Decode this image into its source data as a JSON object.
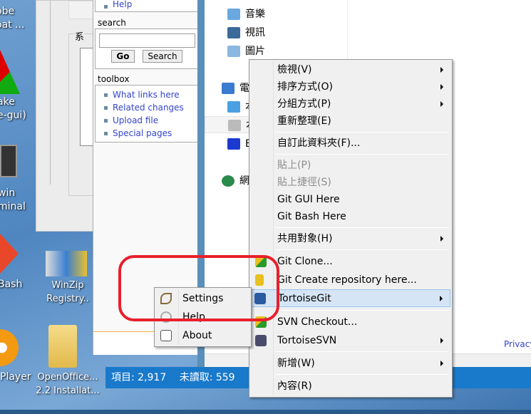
{
  "desktop": {
    "icons": [
      {
        "label": "obe\noat ..."
      },
      {
        "label": "ake\ne-gui)"
      },
      {
        "label": "win\nminal"
      },
      {
        "label": "Bash"
      },
      {
        "label": "Player"
      },
      {
        "label": "WinZip\nRegistry.."
      },
      {
        "label": "OpenOffice...\n2.2 Installat..."
      }
    ]
  },
  "back_window": {
    "fieldset_label": "系"
  },
  "wiki": {
    "nav_item": "Help",
    "search": {
      "heading": "search",
      "value": "",
      "go": "Go",
      "search": "Search"
    },
    "toolbox": {
      "heading": "toolbox",
      "links": [
        "What links here",
        "Related changes",
        "Upload file",
        "Special pages"
      ]
    },
    "privacy": "Privacy"
  },
  "explorer": {
    "nav": [
      "音樂",
      "視訊",
      "圖片",
      "電",
      "本",
      "本",
      "E",
      "網"
    ],
    "status": {
      "items": "項目: 2,917",
      "unread": "未讀取: 559"
    }
  },
  "context_menu": {
    "items": [
      {
        "label": "檢視(V)"
      },
      {
        "label": "排序方式(O)"
      },
      {
        "label": "分組方式(P)"
      },
      {
        "label": "重新整理(E)"
      },
      {
        "label": "自訂此資料夾(F)..."
      },
      {
        "label": "貼上(P)"
      },
      {
        "label": "貼上捷徑(S)"
      },
      {
        "label": "Git GUI Here"
      },
      {
        "label": "Git Bash Here"
      },
      {
        "label": "共用對象(H)"
      },
      {
        "label": "Git Clone..."
      },
      {
        "label": "Git Create repository here..."
      },
      {
        "label": "TortoiseGit"
      },
      {
        "label": "SVN Checkout..."
      },
      {
        "label": "TortoiseSVN"
      },
      {
        "label": "新增(W)"
      },
      {
        "label": "內容(R)"
      }
    ]
  },
  "submenu": {
    "items": [
      "Settings",
      "Help",
      "About"
    ]
  },
  "colors": {
    "highlight": "#d5e5f5",
    "annotation": "#e8202a",
    "status_bar": "#1979ca"
  }
}
